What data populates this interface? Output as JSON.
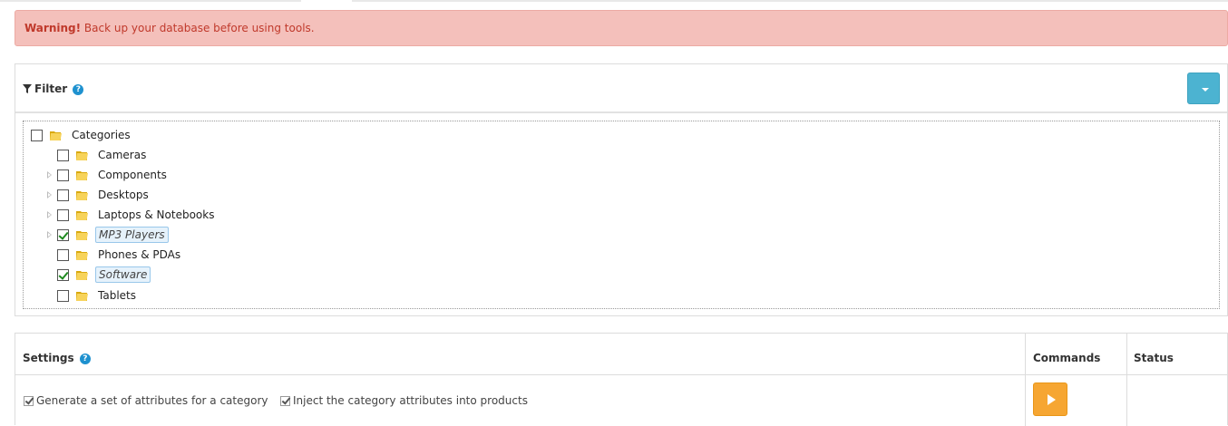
{
  "alert": {
    "strong": "Warning!",
    "text": " Back up your database before using tools.",
    "color": "#c0392b",
    "background": "#f4c0bb"
  },
  "filter": {
    "title": "Filter",
    "funnel_icon": "filter-icon",
    "help_glyph": "?",
    "dropdown_icon": "caret-down-icon",
    "tree": {
      "root": {
        "label": "Categories",
        "checked": false
      },
      "children": [
        {
          "label": "Cameras",
          "checked": false,
          "expandable": false
        },
        {
          "label": "Components",
          "checked": false,
          "expandable": true
        },
        {
          "label": "Desktops",
          "checked": false,
          "expandable": true
        },
        {
          "label": "Laptops & Notebooks",
          "checked": false,
          "expandable": true
        },
        {
          "label": "MP3 Players",
          "checked": true,
          "expandable": true
        },
        {
          "label": "Phones & PDAs",
          "checked": false,
          "expandable": false
        },
        {
          "label": "Software",
          "checked": true,
          "expandable": false
        },
        {
          "label": "Tablets",
          "checked": false,
          "expandable": false
        }
      ]
    }
  },
  "settings": {
    "title": "Settings",
    "help_glyph": "?",
    "commands_header": "Commands",
    "status_header": "Status",
    "option1": "Generate a set of attributes for a category",
    "option2": "Inject the category attributes into products",
    "run_icon": "play-icon",
    "run_color": "#f6a632"
  }
}
